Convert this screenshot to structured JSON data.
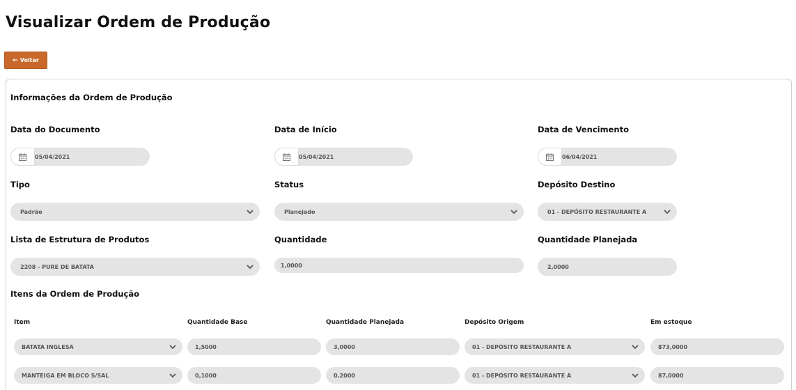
{
  "page": {
    "title": "Visualizar Ordem de Produção"
  },
  "toolbar": {
    "back_label": "Voltar"
  },
  "info": {
    "section_title": "Informações da Ordem de Produção",
    "doc_date": {
      "label": "Data do Documento",
      "value": "05/04/2021"
    },
    "start_date": {
      "label": "Data de Início",
      "value": "05/04/2021"
    },
    "due_date": {
      "label": "Data de Vencimento",
      "value": "06/04/2021"
    },
    "tipo": {
      "label": "Tipo",
      "value": "Padrão"
    },
    "status": {
      "label": "Status",
      "value": "Planejado"
    },
    "deposito_destino": {
      "label": "Depósito Destino",
      "value": "01 - DEPÓSITO RESTAURANTE A"
    },
    "lista": {
      "label": "Lista de Estrutura de Produtos",
      "value": "2208 - PURE DE BATATA"
    },
    "quantidade": {
      "label": "Quantidade",
      "value": "1,0000"
    },
    "quantidade_planejada": {
      "label": "Quantidade Planejada",
      "value": "2,0000"
    }
  },
  "items": {
    "section_title": "Itens da Ordem de Produção",
    "columns": [
      "Item",
      "Quantidade Base",
      "Quantidade Planejada",
      "Depósito Origem",
      "Em estoque"
    ],
    "rows": [
      {
        "item": "BATATA INGLESA",
        "qtd_base": "1,5000",
        "qtd_planejada": "3,0000",
        "deposito": "01 - DEPÓSITO RESTAURANTE A",
        "estoque": "873,0000"
      },
      {
        "item": "MANTEIGA EM BLOCO S/SAL",
        "qtd_base": "0,1000",
        "qtd_planejada": "0,2000",
        "deposito": "01 - DEPÓSITO RESTAURANTE A",
        "estoque": "87,0000"
      }
    ]
  }
}
